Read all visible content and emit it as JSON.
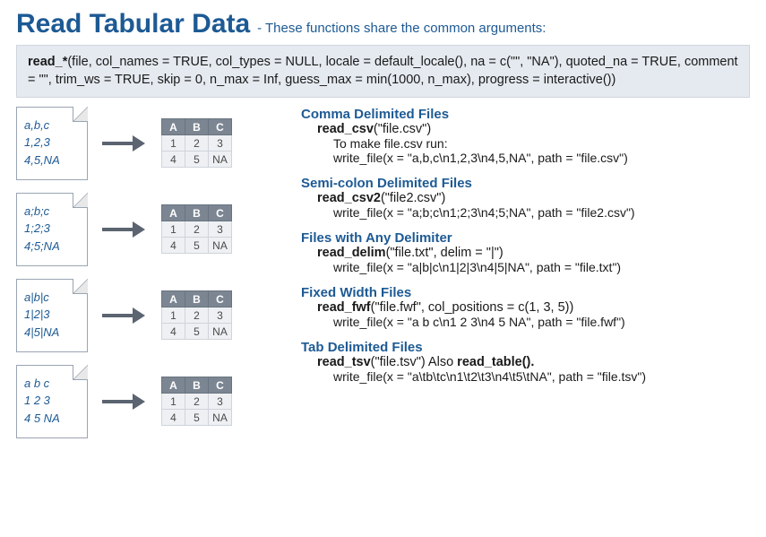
{
  "heading": {
    "title": "Read Tabular Data",
    "subtitle": "- These functions share the common arguments:"
  },
  "signature": {
    "prefix": "read_*",
    "args": "(file, col_names = TRUE, col_types = NULL, locale = default_locale(), na = c(\"\", \"NA\"), quoted_na = TRUE, comment = \"\", trim_ws = TRUE, skip = 0, n_max = Inf, guess_max = min(1000, n_max), progress = interactive())"
  },
  "table": {
    "headers": [
      "A",
      "B",
      "C"
    ],
    "rows": [
      [
        "1",
        "2",
        "3"
      ],
      [
        "4",
        "5",
        "NA"
      ]
    ]
  },
  "examples": [
    {
      "lines": [
        "a,b,c",
        "1,2,3",
        "4,5,NA"
      ]
    },
    {
      "lines": [
        "a;b;c",
        "1;2;3",
        "4;5;NA"
      ]
    },
    {
      "lines": [
        "a|b|c",
        "1|2|3",
        "4|5|NA"
      ]
    },
    {
      "lines": [
        "a b c",
        "1 2 3",
        "4 5 NA"
      ]
    }
  ],
  "blocks": [
    {
      "title": "Comma Delimited Files",
      "fn": "read_csv",
      "args": "(\"file.csv\")",
      "note": "To make file.csv run:",
      "write": "write_file(x = \"a,b,c\\n1,2,3\\n4,5,NA\", path = \"file.csv\")"
    },
    {
      "title": "Semi-colon Delimited Files",
      "fn": "read_csv2",
      "args": "(\"file2.csv\")",
      "write": "write_file(x = \"a;b;c\\n1;2;3\\n4;5;NA\", path = \"file2.csv\")"
    },
    {
      "title": "Files with Any Delimiter",
      "fn": "read_delim",
      "args": "(\"file.txt\", delim = \"|\")",
      "write": "write_file(x = \"a|b|c\\n1|2|3\\n4|5|NA\", path = \"file.txt\")"
    },
    {
      "title": "Fixed Width Files",
      "fn": "read_fwf",
      "args": "(\"file.fwf\", col_positions = c(1, 3, 5))",
      "write": "write_file(x = \"a b c\\n1 2 3\\n4 5 NA\", path = \"file.fwf\")"
    },
    {
      "title": "Tab Delimited Files",
      "fn": "read_tsv",
      "args": "(\"file.tsv\")",
      "also_bold": "read_table().",
      "also_pre": " Also ",
      "write": "write_file(x = \"a\\tb\\tc\\n1\\t2\\t3\\n4\\t5\\tNA\", path = \"file.tsv\")"
    }
  ]
}
